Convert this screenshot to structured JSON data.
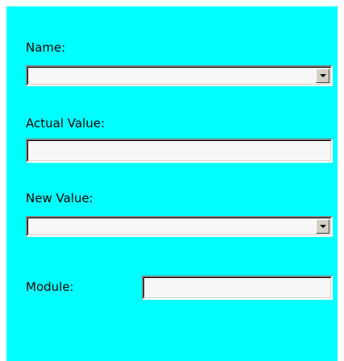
{
  "form": {
    "name": {
      "label": "Name:",
      "value": "",
      "icon": "chevron-down-icon"
    },
    "actual_value": {
      "label": "Actual Value:",
      "value": ""
    },
    "new_value": {
      "label": "New Value:",
      "value": "",
      "icon": "chevron-down-icon"
    },
    "module": {
      "label": "Module:",
      "value": ""
    }
  },
  "colors": {
    "panel_background": "#00ffff",
    "page_background": "#ffffff",
    "field_background": "#f7f7f7",
    "button_face": "#d4d0c8"
  }
}
